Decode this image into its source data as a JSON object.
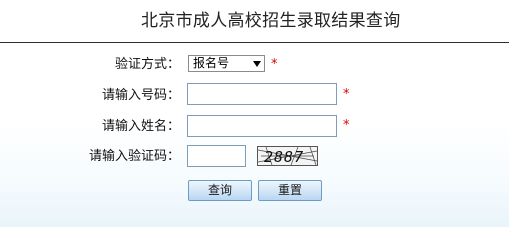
{
  "header": {
    "title": "北京市成人高校招生录取结果查询"
  },
  "form": {
    "verify_method": {
      "label": "验证方式：",
      "selected": "报名号",
      "required_mark": "*"
    },
    "number_field": {
      "label": "请输入号码：",
      "value": "",
      "required_mark": "*"
    },
    "name_field": {
      "label": "请输入姓名：",
      "value": "",
      "required_mark": "*"
    },
    "captcha_field": {
      "label": "请输入验证码：",
      "value": "",
      "captcha_text": "2887"
    }
  },
  "buttons": {
    "query_label": "查询",
    "reset_label": "重置"
  },
  "colors": {
    "required": "#e00000",
    "button_border": "#6e9dc3"
  }
}
